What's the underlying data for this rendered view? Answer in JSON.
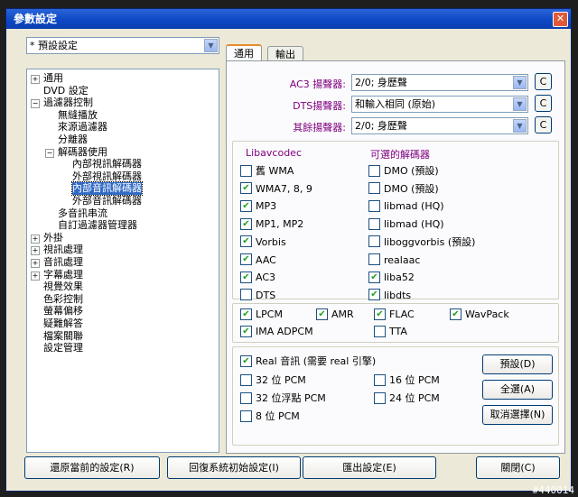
{
  "window": {
    "title": "參數設定"
  },
  "preset": {
    "value": "* 預設設定"
  },
  "tree": [
    {
      "label": "通用",
      "pm": "+"
    },
    {
      "label": "DVD 設定",
      "pm": ""
    },
    {
      "label": "過濾器控制",
      "pm": "-"
    },
    {
      "label": "無縫播放",
      "pm": ""
    },
    {
      "label": "來源過濾器",
      "pm": ""
    },
    {
      "label": "分離器",
      "pm": ""
    },
    {
      "label": "解碼器使用",
      "pm": "-"
    },
    {
      "label": "內部視訊解碼器",
      "pm": ""
    },
    {
      "label": "外部視訊解碼器",
      "pm": ""
    },
    {
      "label": "內部音訊解碼器",
      "pm": ""
    },
    {
      "label": "外部音訊解碼器",
      "pm": ""
    },
    {
      "label": "多音訊串流",
      "pm": ""
    },
    {
      "label": "自訂過濾器管理器",
      "pm": ""
    },
    {
      "label": "外掛",
      "pm": "+"
    },
    {
      "label": "視訊處理",
      "pm": "+"
    },
    {
      "label": "音訊處理",
      "pm": "+"
    },
    {
      "label": "字幕處理",
      "pm": "+"
    },
    {
      "label": "視覺效果",
      "pm": ""
    },
    {
      "label": "色彩控制",
      "pm": ""
    },
    {
      "label": "螢幕偏移",
      "pm": ""
    },
    {
      "label": "疑難解答",
      "pm": ""
    },
    {
      "label": "檔案關聯",
      "pm": ""
    },
    {
      "label": "設定管理",
      "pm": ""
    }
  ],
  "tabs": {
    "general": "通用",
    "output": "輸出"
  },
  "mixers": {
    "ac3_label": "AC3 揚聲器:",
    "ac3_value": "2/0; 身歷聲",
    "dts_label": "DTS揚聲器:",
    "dts_value": "和輸入相同 (原始)",
    "other_label": "其餘揚聲器:",
    "other_value": "2/0; 身歷聲",
    "c_label": "C"
  },
  "libav": {
    "header": "Libavcodec",
    "items": [
      {
        "label": "舊 WMA",
        "checked": false
      },
      {
        "label": "WMA7, 8, 9",
        "checked": true
      },
      {
        "label": "MP3",
        "checked": true
      },
      {
        "label": "MP1, MP2",
        "checked": true
      },
      {
        "label": "Vorbis",
        "checked": true
      },
      {
        "label": "AAC",
        "checked": true
      },
      {
        "label": "AC3",
        "checked": true
      },
      {
        "label": "DTS",
        "checked": false
      }
    ]
  },
  "optional": {
    "header": "可選的解碼器",
    "items": [
      {
        "label": "DMO (預設)",
        "checked": false
      },
      {
        "label": "DMO (預設)",
        "checked": false
      },
      {
        "label": "libmad (HQ)",
        "checked": false
      },
      {
        "label": "libmad (HQ)",
        "checked": false
      },
      {
        "label": "liboggvorbis (預設)",
        "checked": false
      },
      {
        "label": "realaac",
        "checked": false
      },
      {
        "label": "liba52",
        "checked": true
      },
      {
        "label": "libdts",
        "checked": true
      }
    ]
  },
  "lossless": [
    {
      "label": "LPCM",
      "checked": true
    },
    {
      "label": "AMR",
      "checked": true
    },
    {
      "label": "FLAC",
      "checked": true
    },
    {
      "label": "WavPack",
      "checked": true
    },
    {
      "label": "IMA ADPCM",
      "checked": true
    },
    {
      "label": "TTA",
      "checked": false
    }
  ],
  "output": {
    "real": {
      "label": "Real 音訊 (需要 real 引擎)",
      "checked": true
    },
    "items": [
      {
        "label": "32 位 PCM",
        "checked": false
      },
      {
        "label": "16 位 PCM",
        "checked": false
      },
      {
        "label": "32 位浮點 PCM",
        "checked": false
      },
      {
        "label": "24 位 PCM",
        "checked": false
      },
      {
        "label": "8 位 PCM",
        "checked": false
      }
    ],
    "default_btn": "預設(D)",
    "selectall_btn": "全選(A)",
    "deselect_btn": "取消選擇(N)"
  },
  "footer": {
    "restore": "還原當前的設定(R)",
    "reset": "回復系統初始設定(I)",
    "export": "匯出設定(E)",
    "close": "關閉(C)"
  },
  "watermark": "#440014",
  "check_glyph": "✔"
}
